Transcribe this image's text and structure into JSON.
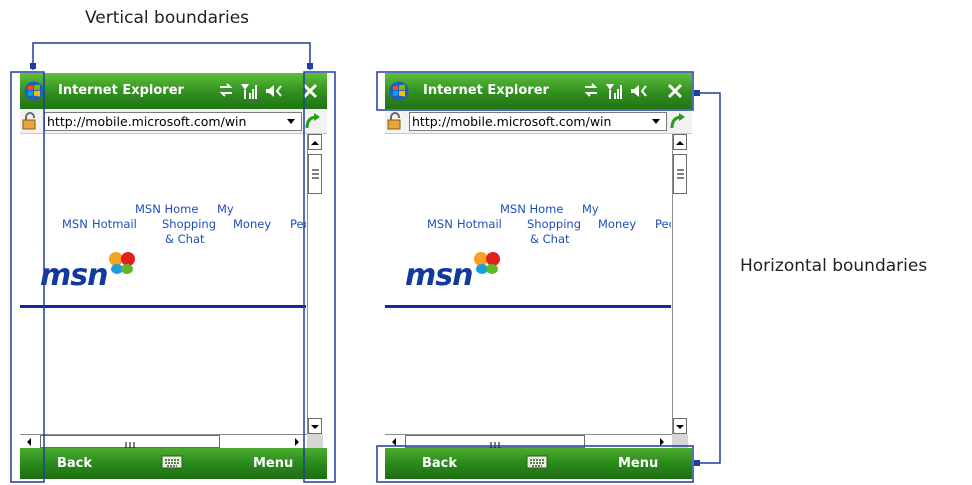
{
  "annotations": {
    "vertical": "Vertical boundaries",
    "horizontal": "Horizontal boundaries"
  },
  "colors": {
    "annotation_line": "#1f3f9c",
    "titlebar_green": "#2f8e1f",
    "link_blue": "#1f4fb8",
    "msn_blue": "#123a9c"
  },
  "screens": [
    {
      "title": "Internet Explorer",
      "url": "http://mobile.microsoft.com/win",
      "nav": {
        "msn": "MSN",
        "hotmail": "Hotmail",
        "msn_home": "MSN Home",
        "shopping": "Shopping",
        "chat": "& Chat",
        "my": "My",
        "money": "Money",
        "peo": "Peo"
      },
      "logo": "msn",
      "menu_left": "Back",
      "menu_right": "Menu"
    },
    {
      "title": "Internet Explorer",
      "url": "http://mobile.microsoft.com/win",
      "nav": {
        "msn": "MSN",
        "hotmail": "Hotmail",
        "msn_home": "MSN Home",
        "shopping": "Shopping",
        "chat": "& Chat",
        "my": "My",
        "money": "Money",
        "peo": "Pec"
      },
      "logo": "msn",
      "menu_left": "Back",
      "menu_right": "Menu"
    }
  ],
  "icons": [
    "windows-start-icon",
    "sync-icon",
    "signal-icon",
    "volume-icon",
    "close-icon",
    "lock-icon",
    "dropdown-arrow-icon",
    "go-arrow-icon",
    "keyboard-icon",
    "butterfly-icon"
  ]
}
